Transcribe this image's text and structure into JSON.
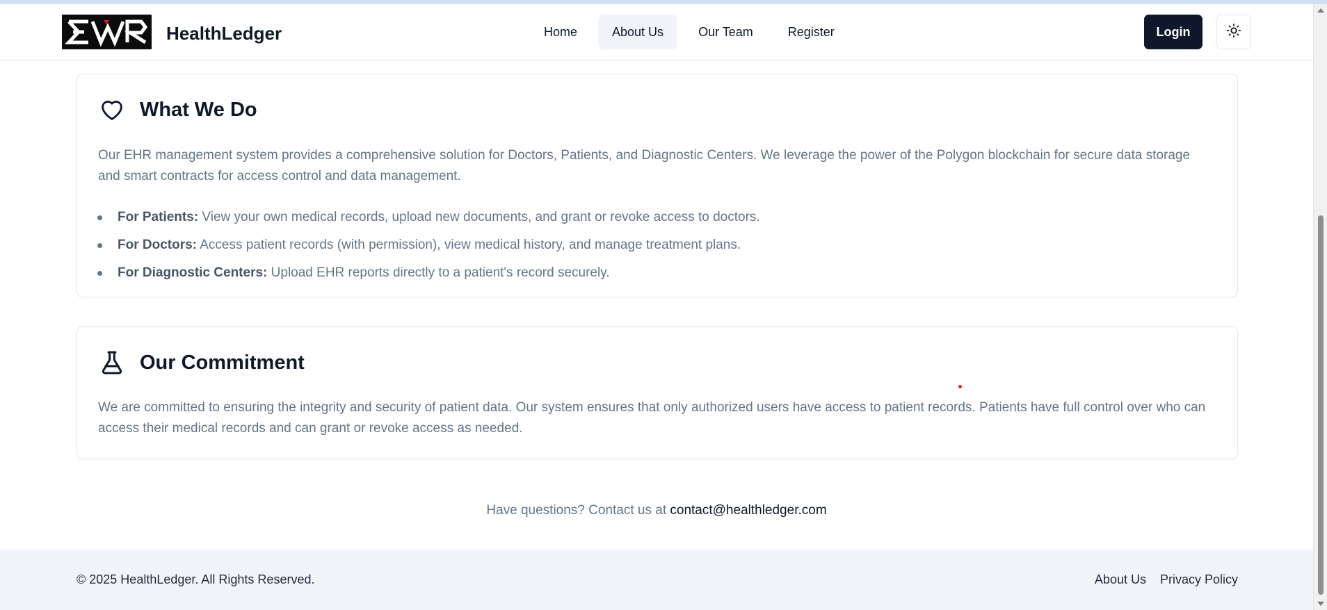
{
  "header": {
    "brand": "HealthLedger",
    "logo_text": "EHR",
    "nav": [
      {
        "label": "Home"
      },
      {
        "label": "About Us",
        "active": true
      },
      {
        "label": "Our Team"
      },
      {
        "label": "Register"
      }
    ],
    "login_label": "Login",
    "theme_icon": "sun-icon"
  },
  "what_we_do": {
    "icon": "heart-icon",
    "title": "What We Do",
    "description": "Our EHR management system provides a comprehensive solution for Doctors, Patients, and Diagnostic Centers. We leverage the power of the Polygon blockchain for secure data storage and smart contracts for access control and data management.",
    "items": [
      {
        "label": "For Patients:",
        "text": " View your own medical records, upload new documents, and grant or revoke access to doctors."
      },
      {
        "label": "For Doctors:",
        "text": " Access patient records (with permission), view medical history, and manage treatment plans."
      },
      {
        "label": "For Diagnostic Centers:",
        "text": " Upload EHR reports directly to a patient's record securely."
      }
    ]
  },
  "commitment": {
    "icon": "flask-icon",
    "title": "Our Commitment",
    "description": "We are committed to ensuring the integrity and security of patient data. Our system ensures that only authorized users have access to patient records. Patients have full control over who can access their medical records and can grant or revoke access as needed."
  },
  "contact": {
    "prefix": "Have questions? Contact us at ",
    "email": "contact@healthledger.com"
  },
  "footer": {
    "copyright": "© 2025 HealthLedger. All Rights Reserved.",
    "links": [
      "About Us",
      "Privacy Policy"
    ]
  },
  "colors": {
    "primary": "#0f172a",
    "muted_text": "#64748b",
    "footer_bg": "#f1f5f9",
    "active_nav_bg": "#f1f5f9"
  }
}
